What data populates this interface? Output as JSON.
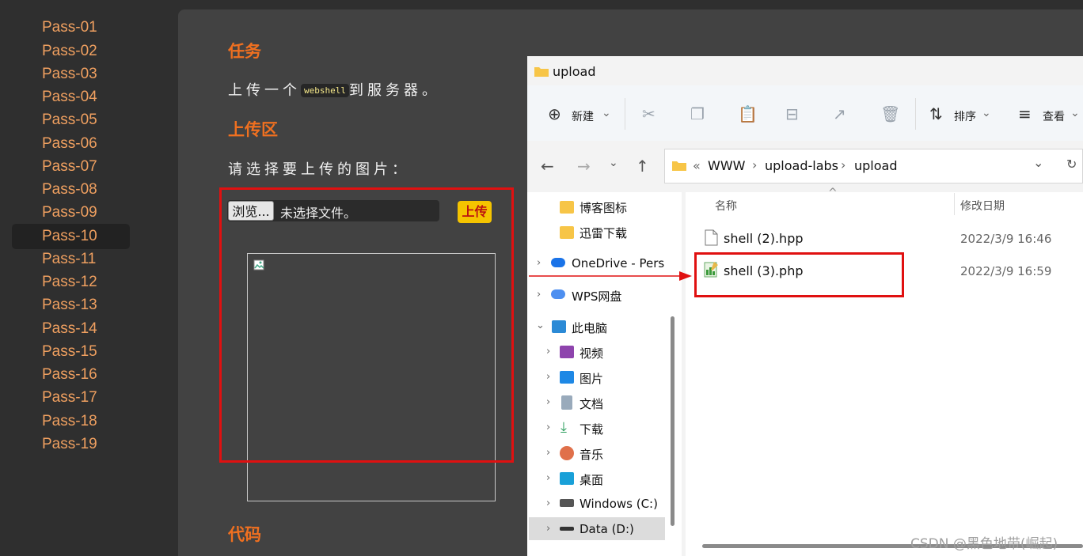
{
  "sidebar": {
    "items": [
      "Pass-01",
      "Pass-02",
      "Pass-03",
      "Pass-04",
      "Pass-05",
      "Pass-06",
      "Pass-07",
      "Pass-08",
      "Pass-09",
      "Pass-10",
      "Pass-11",
      "Pass-12",
      "Pass-13",
      "Pass-14",
      "Pass-15",
      "Pass-16",
      "Pass-17",
      "Pass-18",
      "Pass-19"
    ],
    "active": "Pass-10"
  },
  "main": {
    "task_heading": "任务",
    "task_text_before": "上传一个",
    "task_code": "webshell",
    "task_text_after": "到服务器。",
    "upload_heading": "上传区",
    "select_prompt": "请选择要上传的图片：",
    "browse_label": "浏览...",
    "no_file_text": "未选择文件。",
    "upload_button": "上传",
    "code_heading": "代码"
  },
  "explorer": {
    "title": "upload",
    "toolbar": {
      "new": "新建",
      "sort": "排序",
      "view": "查看"
    },
    "address": {
      "prefix": "«",
      "parts": [
        "WWW",
        "upload-labs",
        "upload"
      ]
    },
    "nav": {
      "items": [
        "博客图标",
        "迅雷下载",
        "OneDrive - Perso",
        "WPS网盘",
        "此电脑",
        "视频",
        "图片",
        "文档",
        "下载",
        "音乐",
        "桌面",
        "Windows (C:)",
        "Data (D:)"
      ]
    },
    "columns": {
      "name": "名称",
      "date": "修改日期"
    },
    "files": [
      {
        "name": "shell (2).hpp",
        "date": "2022/3/9 16:46"
      },
      {
        "name": "shell (3).php",
        "date": "2022/3/9 16:59"
      }
    ]
  },
  "watermark": "CSDN @黑色地带(崛起)",
  "colors": {
    "accent_orange": "#f07020",
    "link_orange": "#f0a060",
    "highlight_red": "#e01010",
    "upload_yellow": "#f5c400"
  }
}
